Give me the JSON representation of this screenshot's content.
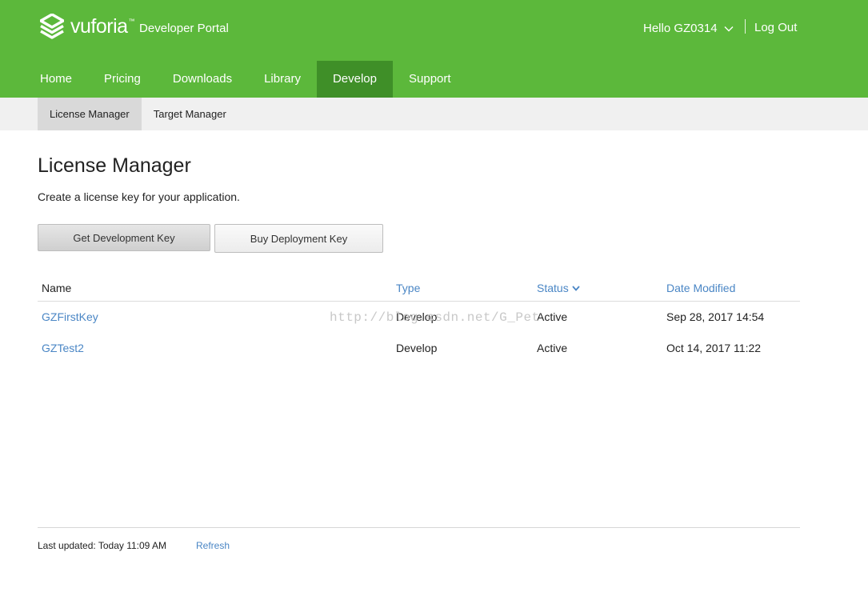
{
  "header": {
    "brand": "vuforia",
    "trademark": "™",
    "portal": "Developer Portal",
    "greeting": "Hello GZ0314",
    "logout": "Log Out",
    "accent_color": "#5cb83b",
    "active_tab_color": "#3f8f28"
  },
  "nav": {
    "items": [
      {
        "label": "Home"
      },
      {
        "label": "Pricing"
      },
      {
        "label": "Downloads"
      },
      {
        "label": "Library"
      },
      {
        "label": "Develop",
        "active": true
      },
      {
        "label": "Support"
      }
    ]
  },
  "subnav": {
    "items": [
      {
        "label": "License Manager",
        "active": true
      },
      {
        "label": "Target Manager"
      }
    ]
  },
  "main": {
    "title": "License Manager",
    "description": "Create a license key for your application.",
    "buttons": {
      "dev_key": "Get Development Key",
      "buy_key": "Buy Deployment Key"
    }
  },
  "table": {
    "columns": {
      "name": "Name",
      "type": "Type",
      "status": "Status",
      "date": "Date Modified"
    },
    "rows": [
      {
        "name": "GZFirstKey",
        "type": "Develop",
        "status": "Active",
        "date": "Sep 28, 2017 14:54"
      },
      {
        "name": "GZTest2",
        "type": "Develop",
        "status": "Active",
        "date": "Oct 14, 2017 11:22"
      }
    ]
  },
  "watermark": "http://blog.csdn.net/G_Pet",
  "footer": {
    "updated": "Last updated: Today 11:09 AM",
    "refresh": "Refresh"
  }
}
